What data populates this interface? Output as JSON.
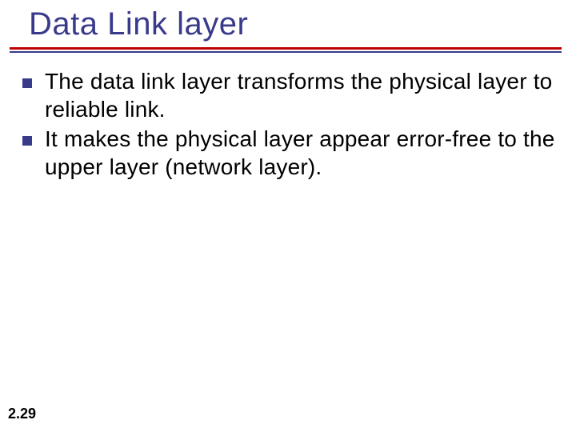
{
  "slide": {
    "title": "Data Link layer",
    "bullets": [
      "The data link layer transforms the physical layer to reliable link.",
      "It makes the physical layer appear error-free to the upper layer (network layer)."
    ],
    "page_number": "2.29"
  }
}
